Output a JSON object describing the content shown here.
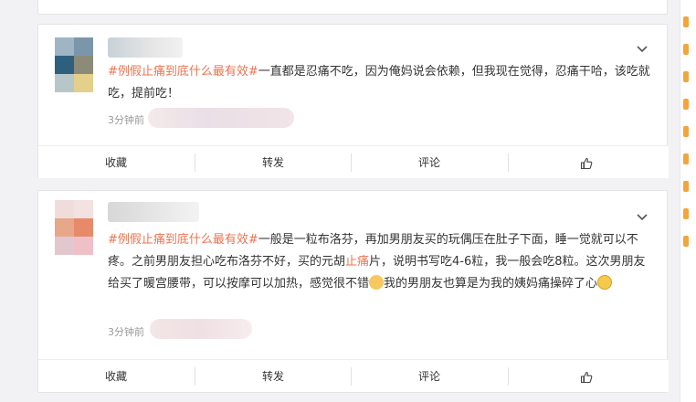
{
  "posts": [
    {
      "hashtag": "#例假止痛到底什么最有效#",
      "text": "一直都是忍痛不吃，因为俺妈说会依赖，但我现在觉得，忍痛干哈，该吃就吃，提前吃！",
      "time": "3分钟前"
    },
    {
      "hashtag": "#例假止痛到底什么最有效#",
      "text_a": "一般是一粒布洛芬，再加男朋友买的玩偶压在肚子下面，睡一觉就可以不疼。之前男朋友担心吃布洛芬不好，买的元胡",
      "highlight": "止痛",
      "text_b": "片，说明书写吃4-6粒，我一般会吃8粒。这次男朋友给买了暖宫腰带，可以按摩可以加热，感觉很不错",
      "text_c": "我的男朋友也算是为我的姨妈痛操碎了心",
      "time": "3分钟前"
    }
  ],
  "actions": {
    "favorite": "收藏",
    "forward": "转发",
    "comment": "评论"
  },
  "colors": {
    "accent": "#eb7350",
    "text": "#333333",
    "meta": "#999999"
  }
}
